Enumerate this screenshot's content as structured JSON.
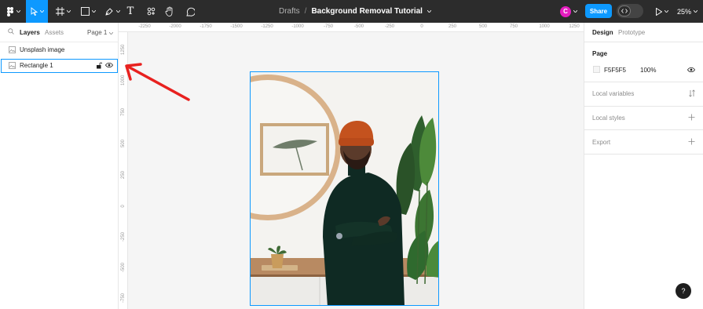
{
  "toolbar": {
    "breadcrumb": "Drafts",
    "separator": "/",
    "doc_title": "Background Removal Tutorial",
    "avatar_initial": "C",
    "share_label": "Share",
    "zoom_label": "25%",
    "text_tool_glyph": "T",
    "accent_color": "#0d99ff",
    "avatar_color": "#e51dbf"
  },
  "left_panel": {
    "tab_layers": "Layers",
    "tab_assets": "Assets",
    "page_selector": "Page 1",
    "layers": [
      {
        "name": "Unsplash image",
        "icon": "image-icon",
        "selected": false
      },
      {
        "name": "Rectangle 1",
        "icon": "image-icon",
        "selected": true
      }
    ]
  },
  "rulers": {
    "top": [
      "-2250",
      "-2000",
      "-1750",
      "-1500",
      "-1250",
      "-1000",
      "-750",
      "-500",
      "-250",
      "0",
      "250",
      "500",
      "750",
      "1000",
      "1250"
    ],
    "left": [
      "1250",
      "1000",
      "750",
      "500",
      "250",
      "0",
      "-250",
      "-500",
      "-750"
    ]
  },
  "right_panel": {
    "tab_design": "Design",
    "tab_prototype": "Prototype",
    "page_heading": "Page",
    "page_color_hex": "F5F5F5",
    "page_color_opacity": "100%",
    "local_variables": "Local variables",
    "local_styles": "Local styles",
    "export": "Export",
    "help_label": "?"
  }
}
